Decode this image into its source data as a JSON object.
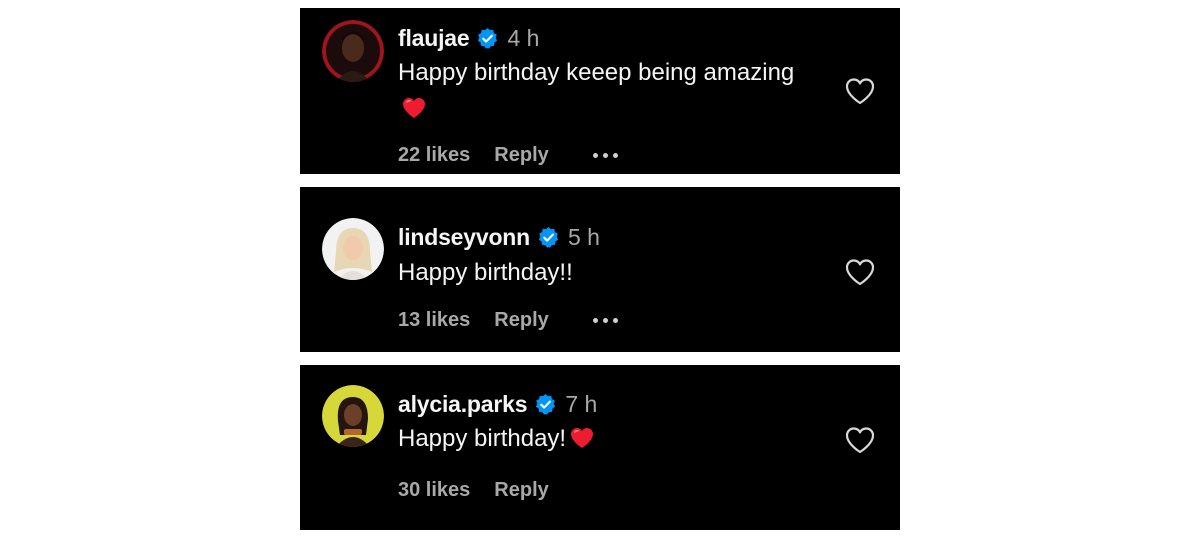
{
  "comments": [
    {
      "username": "flaujae",
      "time": "4 h",
      "text": "Happy birthday keeep being amazing",
      "emoji": "red-heart",
      "likes": "22 likes",
      "reply": "Reply",
      "has_more_menu": true,
      "avatar_icon": "avatar-flaujae",
      "verified_icon": "verified-badge-icon",
      "like_icon": "heart-outline-icon"
    },
    {
      "username": "lindseyvonn",
      "time": "5 h",
      "text": "Happy birthday!!",
      "emoji": "",
      "likes": "13 likes",
      "reply": "Reply",
      "has_more_menu": true,
      "avatar_icon": "avatar-lindseyvonn",
      "verified_icon": "verified-badge-icon",
      "like_icon": "heart-outline-icon"
    },
    {
      "username": "alycia.parks",
      "time": "7 h",
      "text": "Happy birthday!",
      "emoji": "red-heart",
      "likes": "30 likes",
      "reply": "Reply",
      "has_more_menu": false,
      "avatar_icon": "avatar-alycia-parks",
      "verified_icon": "verified-badge-icon",
      "like_icon": "heart-outline-icon"
    }
  ],
  "colors": {
    "background": "#000000",
    "text_primary": "#f5f5f5",
    "text_secondary": "#a8a8a8",
    "verified_blue": "#0095f6",
    "heart_red": "#ed1c2e"
  }
}
